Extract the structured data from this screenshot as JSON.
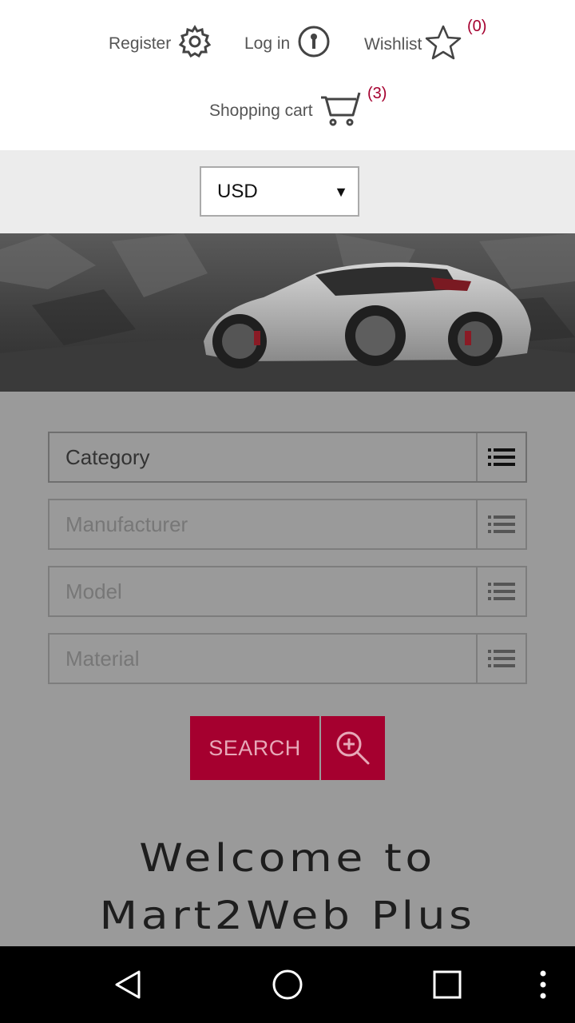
{
  "header": {
    "register_label": "Register",
    "login_label": "Log in",
    "wishlist_label": "Wishlist",
    "wishlist_count": "(0)",
    "cart_label": "Shopping cart",
    "cart_count": "(3)"
  },
  "currency": {
    "selected": "USD",
    "arrow": "▼"
  },
  "filters": [
    {
      "label": "Category"
    },
    {
      "label": "Manufacturer"
    },
    {
      "label": "Model"
    },
    {
      "label": "Material"
    }
  ],
  "search": {
    "button_label": "SEARCH"
  },
  "welcome": {
    "line1": "Welcome to",
    "line2": "Mart2Web Plus"
  },
  "icons": {
    "register": "gear-icon",
    "login": "key-icon",
    "wishlist": "star-icon",
    "cart": "cart-icon",
    "filter": "list-icon",
    "search": "magnifier-plus-icon"
  },
  "colors": {
    "accent": "#a5002f",
    "overlay": "#9a9a9a",
    "navbar": "#000000"
  }
}
